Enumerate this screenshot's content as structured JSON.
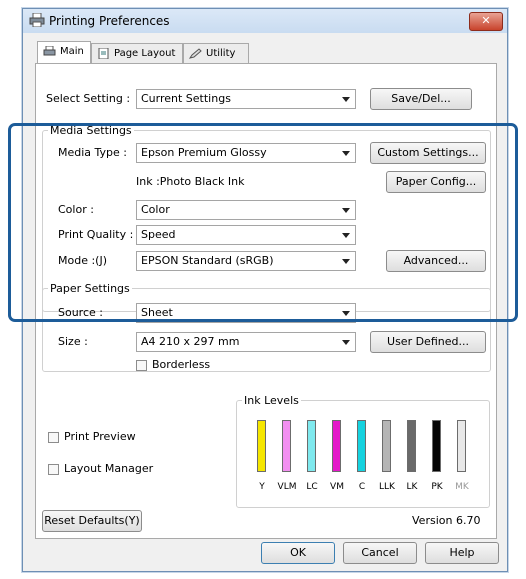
{
  "window": {
    "title": "Printing Preferences",
    "close_label": "✕"
  },
  "tabs": [
    {
      "label": "Main"
    },
    {
      "label": "Page Layout"
    },
    {
      "label": "Utility"
    }
  ],
  "select_setting": {
    "label": "Select Setting :",
    "value": "Current Settings",
    "save_button": "Save/Del..."
  },
  "media_settings_title": "Media Settings",
  "media_type": {
    "label": "Media Type :",
    "value": "Epson Premium Glossy",
    "custom_button": "Custom Settings..."
  },
  "ink": {
    "text": "Ink :Photo Black Ink",
    "paper_config_button": "Paper Config..."
  },
  "color": {
    "label": "Color :",
    "value": "Color"
  },
  "print_quality": {
    "label": "Print Quality :",
    "value": "Speed"
  },
  "mode": {
    "label": "Mode :(J)",
    "value": "EPSON Standard (sRGB)",
    "advanced_button": "Advanced..."
  },
  "paper_settings": {
    "title": "Paper Settings",
    "source": {
      "label": "Source :",
      "value": "Sheet"
    },
    "size": {
      "label": "Size :",
      "value": "A4 210 x 297 mm",
      "user_defined_button": "User Defined..."
    },
    "borderless_label": "Borderless"
  },
  "print_preview_label": "Print Preview",
  "layout_manager_label": "Layout Manager",
  "ink_levels": {
    "title": "Ink Levels",
    "inks": [
      {
        "name": "Y",
        "color": "#f5e600",
        "level": 1.0
      },
      {
        "name": "VLM",
        "color": "#f28ff0",
        "level": 1.0
      },
      {
        "name": "LC",
        "color": "#7fe9ee",
        "level": 1.0
      },
      {
        "name": "VM",
        "color": "#e418c9",
        "level": 1.0
      },
      {
        "name": "C",
        "color": "#15d2df",
        "level": 1.0
      },
      {
        "name": "LLK",
        "color": "#b5b5b5",
        "level": 1.0
      },
      {
        "name": "LK",
        "color": "#6a6a6a",
        "level": 1.0
      },
      {
        "name": "PK",
        "color": "#050505",
        "level": 1.0
      },
      {
        "name": "MK",
        "color": "#e8e8e8",
        "level": 1.0
      }
    ]
  },
  "reset_defaults_button": "Reset Defaults(Y)",
  "version": "Version 6.70",
  "footer": {
    "ok": "OK",
    "cancel": "Cancel",
    "help": "Help"
  },
  "highlight_color": "#1d5c99"
}
